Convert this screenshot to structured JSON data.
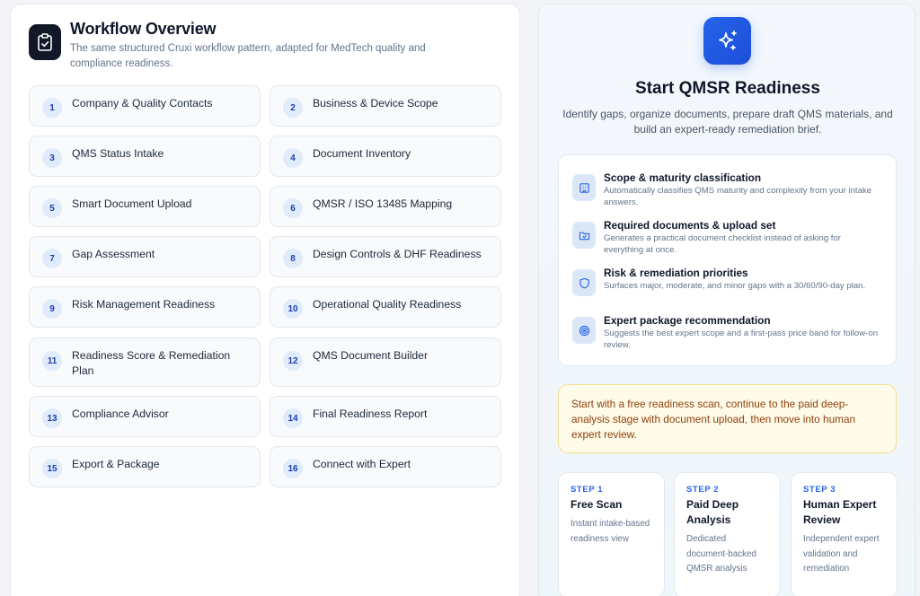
{
  "workflow": {
    "title": "Workflow Overview",
    "subtitle": "The same structured Cruxi workflow pattern, adapted for MedTech quality and compliance readiness.",
    "icon": "clipboard-check-icon",
    "steps": [
      {
        "num": "1",
        "label": "Company & Quality Contacts"
      },
      {
        "num": "2",
        "label": "Business & Device Scope"
      },
      {
        "num": "3",
        "label": "QMS Status Intake"
      },
      {
        "num": "4",
        "label": "Document Inventory"
      },
      {
        "num": "5",
        "label": "Smart Document Upload"
      },
      {
        "num": "6",
        "label": "QMSR / ISO 13485 Mapping"
      },
      {
        "num": "7",
        "label": "Gap Assessment"
      },
      {
        "num": "8",
        "label": "Design Controls & DHF Readiness"
      },
      {
        "num": "9",
        "label": "Risk Management Readiness"
      },
      {
        "num": "10",
        "label": "Operational Quality Readiness"
      },
      {
        "num": "11",
        "label": "Readiness Score & Remediation Plan"
      },
      {
        "num": "12",
        "label": "QMS Document Builder"
      },
      {
        "num": "13",
        "label": "Compliance Advisor"
      },
      {
        "num": "14",
        "label": "Final Readiness Report"
      },
      {
        "num": "15",
        "label": "Export & Package"
      },
      {
        "num": "16",
        "label": "Connect with Expert"
      }
    ]
  },
  "readiness": {
    "icon": "sparkles-icon",
    "title": "Start QMSR Readiness",
    "description": "Identify gaps, organize documents, prepare draft QMS materials, and build an expert-ready remediation brief.",
    "features": [
      {
        "icon": "building-icon",
        "title": "Scope & maturity classification",
        "desc": "Automatically classifies QMS maturity and complexity from your intake answers."
      },
      {
        "icon": "folder-upload-icon",
        "title": "Required documents & upload set",
        "desc": "Generates a practical document checklist instead of asking for everything at once."
      },
      {
        "icon": "shield-icon",
        "title": "Risk & remediation priorities",
        "desc": "Surfaces major, moderate, and minor gaps with a 30/60/90-day plan."
      },
      {
        "icon": "target-icon",
        "title": "Expert package recommendation",
        "desc": "Suggests the best expert scope and a first-pass price band for follow-on review."
      }
    ],
    "notice": "Start with a free readiness scan, continue to the paid deep-analysis stage with document upload, then move into human expert review.",
    "phases": [
      {
        "step": "STEP 1",
        "title": "Free Scan",
        "desc": "Instant intake-based readiness view"
      },
      {
        "step": "STEP 2",
        "title": "Paid Deep Analysis",
        "desc": "Dedicated document-backed QMSR analysis"
      },
      {
        "step": "STEP 3",
        "title": "Human Expert Review",
        "desc": "Independent expert validation and remediation"
      }
    ]
  },
  "colors": {
    "accent": "#2563eb",
    "dark_icon_bg": "#111827",
    "notice_bg": "#fefbe8",
    "notice_text": "#92400e"
  }
}
